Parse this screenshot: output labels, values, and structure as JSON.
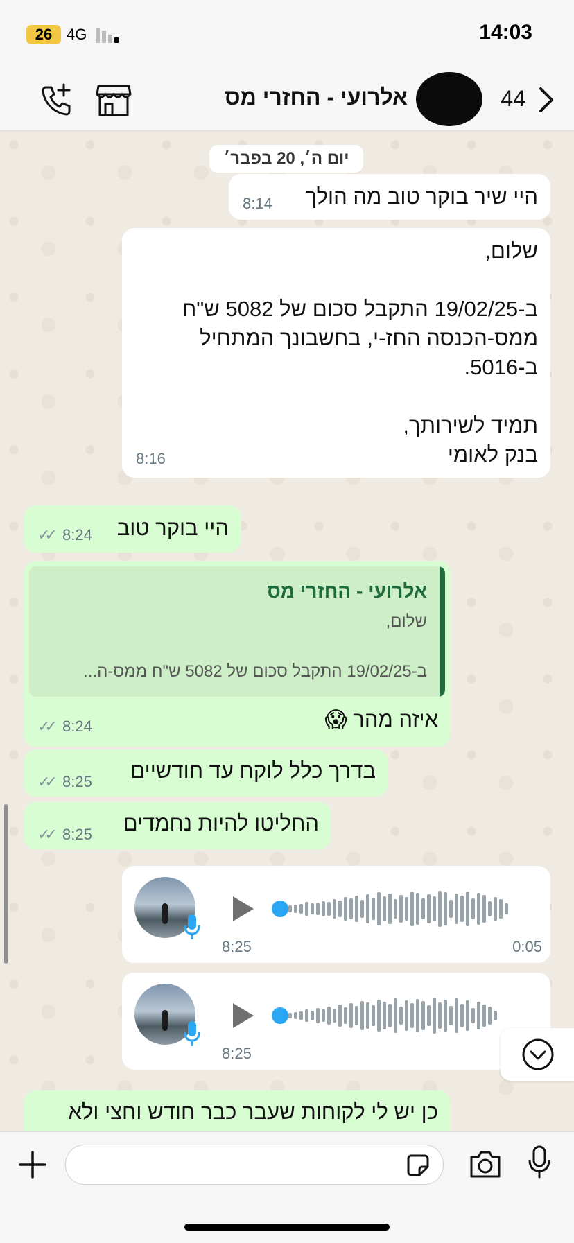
{
  "status_bar": {
    "battery": "26",
    "network": "4G",
    "time": "14:03"
  },
  "header": {
    "back_count": "44",
    "title": "אלרועי - החזרי מס"
  },
  "chat": {
    "date_label": "יום ה׳, 20 בפבר׳",
    "messages": [
      {
        "text": "היי שיר בוקר טוב מה הולך",
        "time": "8:14"
      },
      {
        "text": "שלום,\n\nב-19/02/25 התקבל סכום של 5082 ש\"ח\nממס-הכנסה החז-י, בחשבונך המתחיל\nב-5016.\n\nתמיד לשירותך,\nבנק לאומי",
        "time": "8:16"
      },
      {
        "text": "היי בוקר טוב",
        "time": "8:24"
      },
      {
        "quote_name": "אלרועי - החזרי מס",
        "quote_line1": "שלום,",
        "quote_line2": "ב-19/02/25 התקבל סכום של 5082 ש\"ח ממס-ה...",
        "text": "איזה מהר 😱",
        "time": "8:24"
      },
      {
        "text": "בדרך כלל לוקח עד חודשיים",
        "time": "8:25"
      },
      {
        "text": "החליטו להיות נחמדים",
        "time": "8:25"
      },
      {
        "voice_time": "8:25",
        "duration": "0:05"
      },
      {
        "voice_time": "8:25"
      },
      {
        "text": "כן יש לי לקוחות שעבר כבר חודש וחצי ולא"
      }
    ]
  }
}
